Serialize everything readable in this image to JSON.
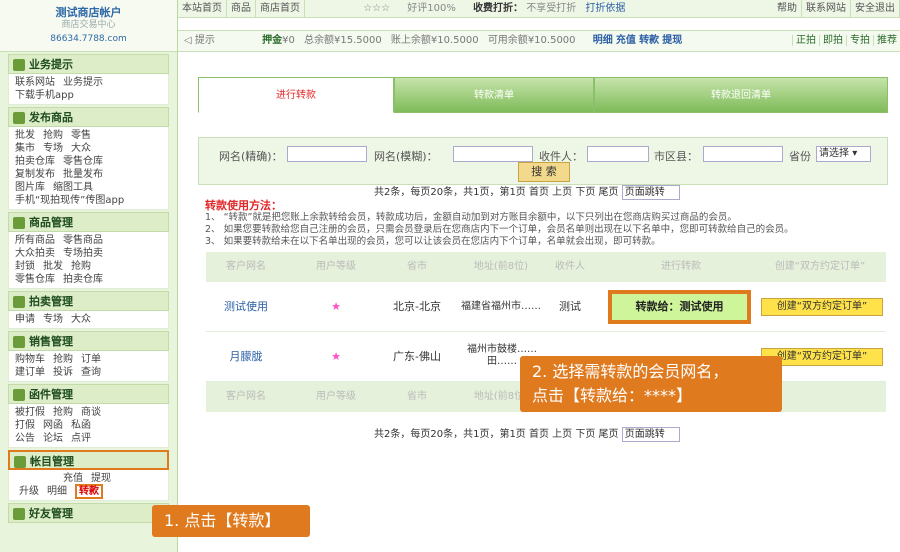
{
  "header": {
    "shop": "测试商店帐户",
    "sub": "商店交易中心",
    "url": "86634.7788.com"
  },
  "topbar": {
    "items": [
      "本站首页",
      "商品",
      "商店首页"
    ],
    "stars": "☆☆☆",
    "rating": "好评100%",
    "fee_label": "收费打折：",
    "fee_val": "不享受打折",
    "fee_link": "打折依据",
    "right": [
      "帮助",
      "联系网站",
      "安全退出"
    ]
  },
  "bar2": {
    "tip": "提示",
    "deposit_label": "押金",
    "deposit": "¥0",
    "total_label": "总余额",
    "total": "¥15.5000",
    "acct_label": "账上余额",
    "acct": "¥10.5000",
    "avail_label": "可用余额",
    "avail": "¥10.5000",
    "links": [
      "明细",
      "充值",
      "转款",
      "提现"
    ],
    "right": [
      "正拍",
      "即拍",
      "专拍",
      "推荐"
    ]
  },
  "sidebar": [
    {
      "title": "业务提示",
      "rows": [
        [
          "联系网站",
          "业务提示"
        ],
        [
          "下载手机app"
        ]
      ]
    },
    {
      "title": "发布商品",
      "rows": [
        [
          "批发",
          "抢购",
          "零售"
        ],
        [
          "集市",
          "专场",
          "大众"
        ],
        [
          "拍卖仓库",
          "零售仓库"
        ],
        [
          "复制发布",
          "批量发布"
        ],
        [
          "图片库",
          "缩图工具"
        ],
        [
          "手机“现拍现传”传图app"
        ]
      ]
    },
    {
      "title": "商品管理",
      "rows": [
        [
          "所有商品",
          "零售商品"
        ],
        [
          "大众拍卖",
          "专场拍卖"
        ],
        [
          "封锁",
          "批发",
          "抢购"
        ],
        [
          "零售仓库",
          "拍卖仓库"
        ]
      ]
    },
    {
      "title": "拍卖管理",
      "rows": [
        [
          "申请",
          "专场",
          "大众"
        ]
      ]
    },
    {
      "title": "销售管理",
      "rows": [
        [
          "购物车",
          "抢购",
          "订单"
        ],
        [
          "建订单",
          "投诉",
          "查询"
        ]
      ]
    },
    {
      "title": "函件管理",
      "rows": [
        [
          "被打假",
          "抢购",
          "商谈"
        ],
        [
          "打假",
          "网函",
          "私函"
        ],
        [
          "公告",
          "论坛",
          "点评"
        ]
      ]
    },
    {
      "title": "帐目管理",
      "rows": [
        [
          "充值",
          "提现"
        ],
        [
          "升级",
          "明细",
          "转款"
        ]
      ]
    },
    {
      "title": "好友管理",
      "rows": []
    }
  ],
  "tabs": [
    "进行转款",
    "转款清单",
    "转款退回清单"
  ],
  "search": {
    "l1": "网名(精确)：",
    "l2": "网名(模糊)：",
    "l3": "收件人：",
    "l4": "市区县：",
    "l5": "省份",
    "prov": "请选择",
    "btn": "搜 索"
  },
  "pager": {
    "text": "共2条，每页20条，共1页，第1页 首页 上页 下页 尾页",
    "jump": "页面跳转"
  },
  "help": {
    "title": "转款使用方法：",
    "lines": [
      "1、 “转款”就是把您账上余款转给会员，转款成功后，金额自动加到对方账目余额中，以下只列出在您商店购买过商品的会员。",
      "2、 如果您要转款给您自己注册的会员，只需会员登录后在您商店内下一个订单，会员名单则出现在以下名单中，您即可转款给自己的会员。",
      "3、 如果要转款给未在以下名单出现的会员，您可以让该会员在您店内下个订单，名单就会出现，即可转款。"
    ]
  },
  "table": {
    "cols": [
      "客户网名",
      "用户等级",
      "省市",
      "地址(前8位)",
      "收件人",
      "进行转款",
      "创建“双方约定订单”"
    ],
    "rows": [
      {
        "name": "测试使用",
        "star": "★",
        "city": "北京-北京",
        "addr": "福建省福州市……",
        "rcpt": "测试",
        "btn": "转款给：测试使用",
        "btn2": "创建“双方约定订单”"
      },
      {
        "name": "月朦胧",
        "star": "★",
        "city": "广东-佛山",
        "addr": "福州市鼓楼……田……",
        "rcpt": "",
        "btn": "",
        "btn2": "创建“双方约定订单”"
      }
    ]
  },
  "callouts": {
    "c1": "1. 点击【转款】",
    "c2a": "2. 选择需转款的会员网名，",
    "c2b": "点击【转款给：****】"
  }
}
